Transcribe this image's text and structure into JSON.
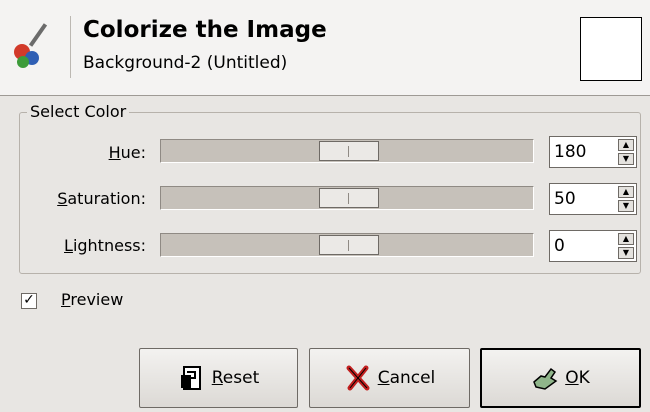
{
  "dialog": {
    "title": "Colorize the Image",
    "subtitle": "Background-2 (Untitled)",
    "header_icon": "paint-palette-icon",
    "swatch_color": "#ffffff"
  },
  "select_color": {
    "frame_label": "Select Color",
    "hue": {
      "label_mnemonic": "H",
      "label_rest": "ue:",
      "value": "180",
      "slider_fraction": 0.5
    },
    "saturation": {
      "label_mnemonic": "S",
      "label_rest": "aturation:",
      "value": "50",
      "slider_fraction": 0.5
    },
    "lightness": {
      "label_mnemonic": "L",
      "label_rest": "ightness:",
      "value": "0",
      "slider_fraction": 0.5
    }
  },
  "preview": {
    "label_mnemonic": "P",
    "label_rest": "review",
    "checked": true
  },
  "buttons": {
    "reset": {
      "mnemonic": "R",
      "rest": "eset",
      "icon": "reset-icon"
    },
    "cancel": {
      "mnemonic": "C",
      "rest": "ancel",
      "icon": "cancel-x-icon"
    },
    "ok": {
      "mnemonic": "O",
      "rest": "K",
      "icon": "ok-hand-icon"
    }
  }
}
